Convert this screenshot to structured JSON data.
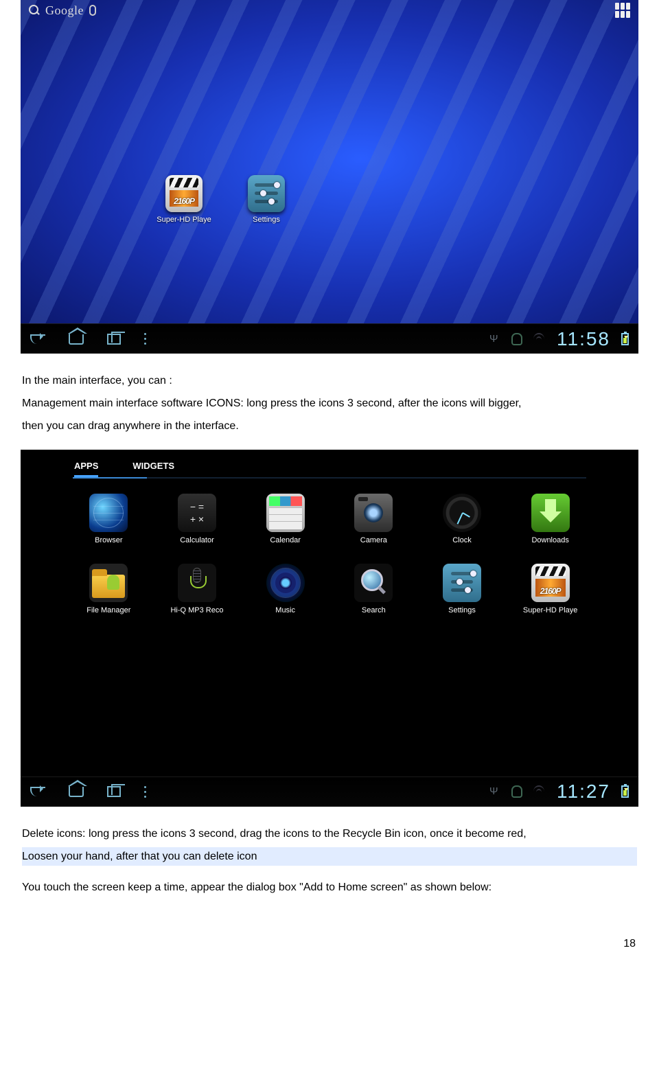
{
  "shot1": {
    "search_label": "Google",
    "home_icons": [
      {
        "label": "Super-HD Playe",
        "tag": "2160P"
      },
      {
        "label": "Settings"
      }
    ],
    "clock": "11:58"
  },
  "para1": {
    "l1": "In the main interface, you can :",
    "l2": "Management main interface software ICONS: long press the icons 3 second, after the icons will bigger,",
    "l3": "then you can drag anywhere in the interface."
  },
  "shot2": {
    "tabs": {
      "apps": "APPS",
      "widgets": "WIDGETS"
    },
    "apps": [
      {
        "label": "Browser"
      },
      {
        "label": "Calculator"
      },
      {
        "label": "Calendar"
      },
      {
        "label": "Camera"
      },
      {
        "label": "Clock"
      },
      {
        "label": "Downloads"
      },
      {
        "label": "File Manager"
      },
      {
        "label": "Hi-Q MP3 Reco"
      },
      {
        "label": "Music"
      },
      {
        "label": "Search"
      },
      {
        "label": "Settings"
      },
      {
        "label": "Super-HD Playe"
      }
    ],
    "clock": "11:27"
  },
  "para2": {
    "l1": "Delete icons: long press the icons 3 second, drag the icons to the Recycle Bin icon, once it become red,",
    "l2": "Loosen your hand, after that you can delete icon",
    "l3": "You touch the screen keep a time, appear the dialog box \"Add to Home screen\" as shown below:"
  },
  "page_number": "18"
}
